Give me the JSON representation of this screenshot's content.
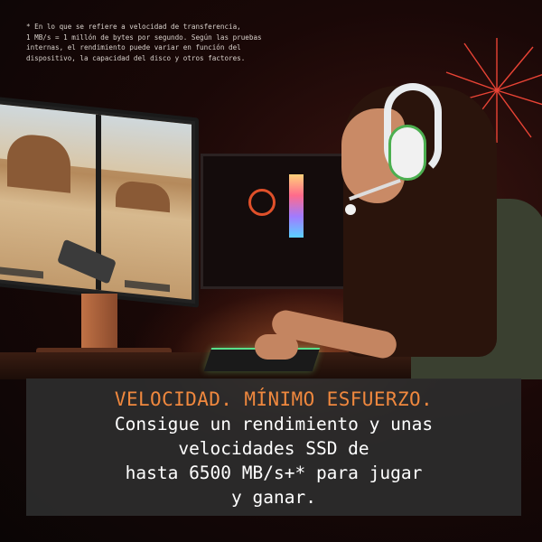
{
  "disclaimer": "* En lo que se refiere a velocidad de transferencia,\n1 MB/s = 1 millón de bytes por segundo. Según las pruebas\ninternas, el rendimiento puede variar en función del\ndispositivo, la capacidad del disco y otros factores.",
  "caption": {
    "headline": "VELOCIDAD. MÍNIMO ESFUERZO.",
    "body": "Consigue un rendimiento y unas\nvelocidades SSD de\nhasta 6500 MB/s+* para jugar\ny ganar."
  },
  "colors": {
    "headline": "#f0883e",
    "panel": "#2c2c2c",
    "body_text": "#ffffff"
  },
  "icons": [
    "headset-icon",
    "gaming-monitor",
    "gaming-keyboard"
  ]
}
